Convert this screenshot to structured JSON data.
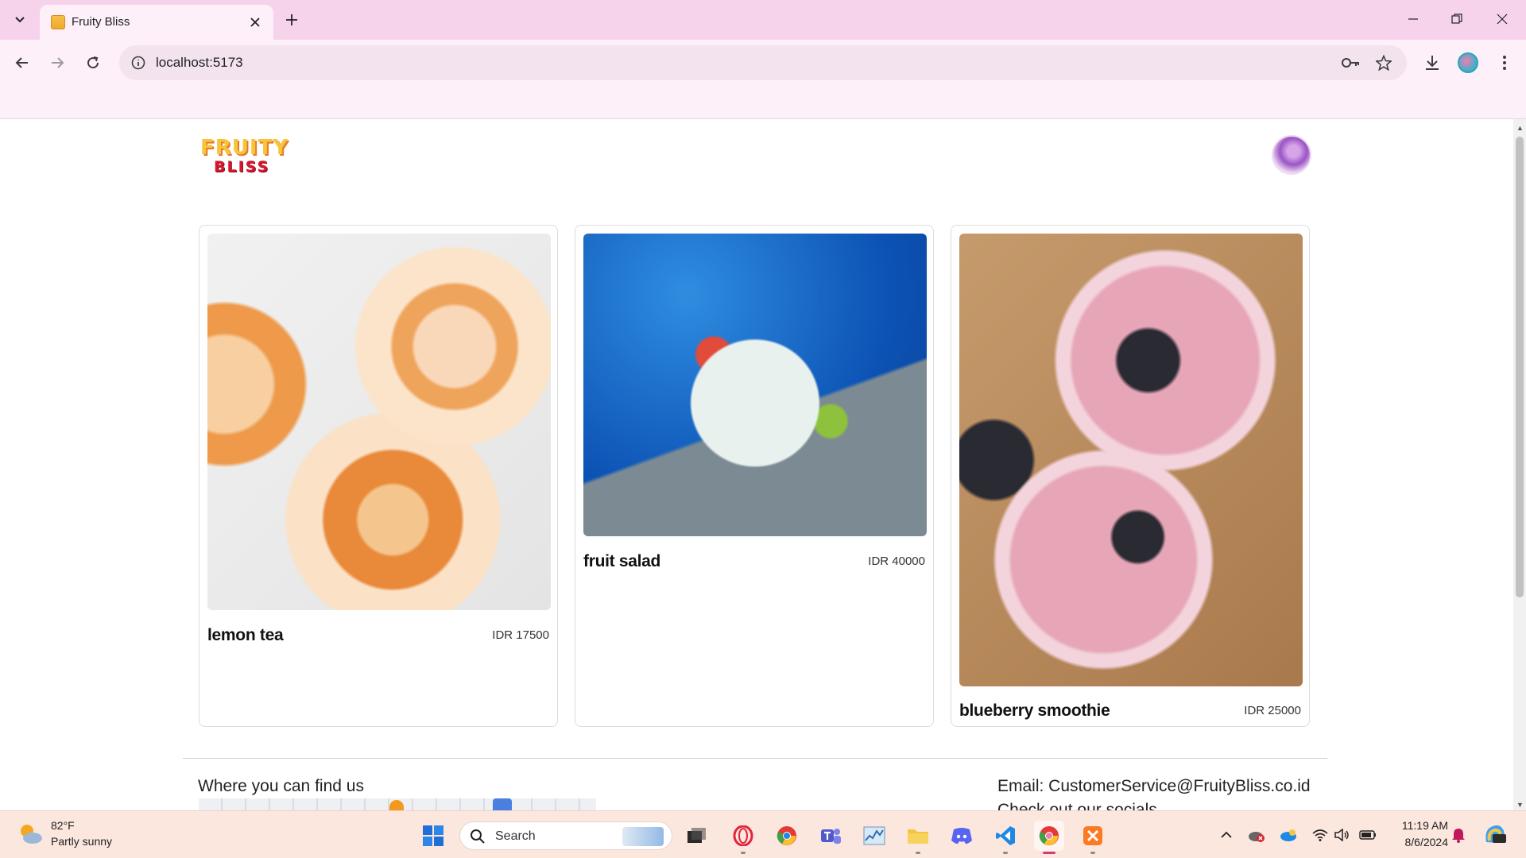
{
  "browser": {
    "tab_title": "Fruity Bliss",
    "url": "localhost:5173"
  },
  "site": {
    "logo_top": "FRUITY",
    "logo_bottom": "BLISS"
  },
  "products": [
    {
      "name": "lemon tea",
      "price": "IDR 17500",
      "image": "iced lemon tea glasses"
    },
    {
      "name": "fruit salad",
      "price": "IDR 40000",
      "image": "fruit platter by pool"
    },
    {
      "name": "blueberry smoothie",
      "price": "IDR 25000",
      "image": "berry smoothie jars"
    }
  ],
  "footer": {
    "find_us": "Where you can find us",
    "email": "Email: CustomerService@FruityBliss.co.id",
    "socials": "Check out our socials"
  },
  "taskbar": {
    "weather_temp": "82°F",
    "weather_desc": "Partly sunny",
    "search_placeholder": "Search",
    "time": "11:19 AM",
    "date": "8/6/2024"
  },
  "colors": {
    "tabbar": "#f6d3ea",
    "toolbar": "#fdf0f8",
    "taskbar": "#fce7df",
    "logo_yellow": "#f7c43a",
    "logo_red": "#d8172e"
  }
}
